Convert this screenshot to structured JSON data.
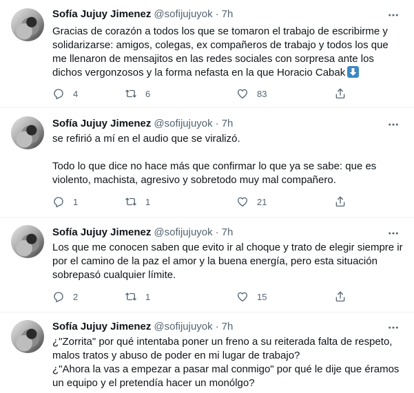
{
  "tweets": [
    {
      "author": "Sofía Jujuy Jimenez",
      "handle": "@sofijujuyok",
      "time": "7h",
      "paragraphs": [
        "Gracias de corazón a todos los que se tomaron el trabajo de escribirme y solidarizarse: amigos, colegas, ex compañeros de trabajo y todos los que me llenaron de mensajitos en las redes sociales con sorpresa ante los dichos vergonzosos y la forma nefasta en la que Horacio Cabak"
      ],
      "emoji": "down-arrow-emoji",
      "replies": "4",
      "retweets": "6",
      "likes": "83"
    },
    {
      "author": "Sofía Jujuy Jimenez",
      "handle": "@sofijujuyok",
      "time": "7h",
      "paragraphs": [
        "se refirió a mí en el audio que se viralizó.",
        "Todo lo que dice no hace más que confirmar lo que ya se sabe: que es violento, machista, agresivo y sobretodo muy mal compañero."
      ],
      "replies": "1",
      "retweets": "1",
      "likes": "21"
    },
    {
      "author": "Sofía Jujuy Jimenez",
      "handle": "@sofijujuyok",
      "time": "7h",
      "paragraphs": [
        "Los que me conocen saben que evito ir al choque y trato de elegir siempre ir por el camino de la paz el amor y la buena energía, pero esta situación sobrepasó cualquier límite."
      ],
      "replies": "2",
      "retweets": "1",
      "likes": "15"
    },
    {
      "author": "Sofía Jujuy Jimenez",
      "handle": "@sofijujuyok",
      "time": "7h",
      "paragraphs": [
        "¿\"Zorrita\" por qué intentaba poner un freno a su reiterada falta de respeto, malos tratos y abuso de poder en mi lugar de trabajo?",
        "¿\"Ahora la vas a empezar a pasar mal conmigo\" por qué le dije que éramos un equipo y el pretendía hacer un monólgo?"
      ]
    }
  ],
  "separator": "·",
  "colors": {
    "text": "#0f1419",
    "secondary": "#536471",
    "divider": "#eff3f4",
    "emoji_bg": "#3b88c3"
  },
  "icons": [
    "more-icon",
    "reply-icon",
    "retweet-icon",
    "like-icon",
    "share-icon"
  ]
}
